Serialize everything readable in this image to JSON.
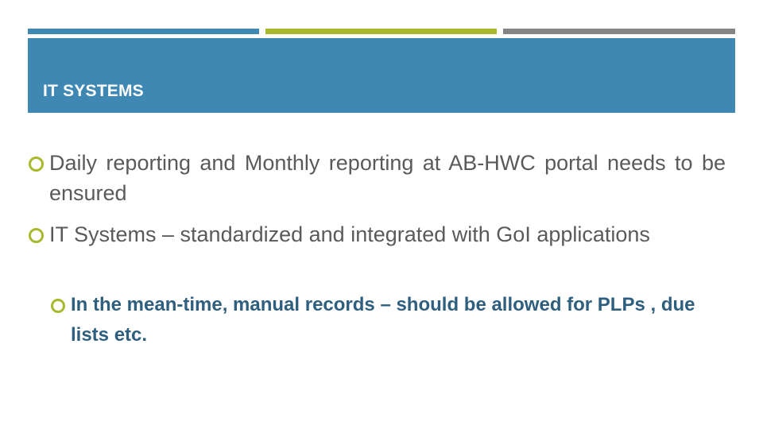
{
  "slide": {
    "title": "IT SYSTEMS",
    "colors": {
      "accent_blue": "#3f88b4",
      "accent_green": "#a8b92c",
      "accent_gray": "#858585",
      "body_text": "#5a5a5a",
      "sub_text": "#2f5f7f"
    },
    "bullets": [
      {
        "level": 1,
        "icon": "circle-bullet-icon",
        "text": "Daily reporting and Monthly reporting at AB-HWC portal needs to be ensured"
      },
      {
        "level": 1,
        "icon": "circle-bullet-icon",
        "text": "IT Systems – standardized and integrated with GoI applications"
      },
      {
        "level": 2,
        "icon": "circle-bullet-icon",
        "text": "In the mean-time, manual records – should be allowed for PLPs , due lists etc."
      }
    ]
  }
}
